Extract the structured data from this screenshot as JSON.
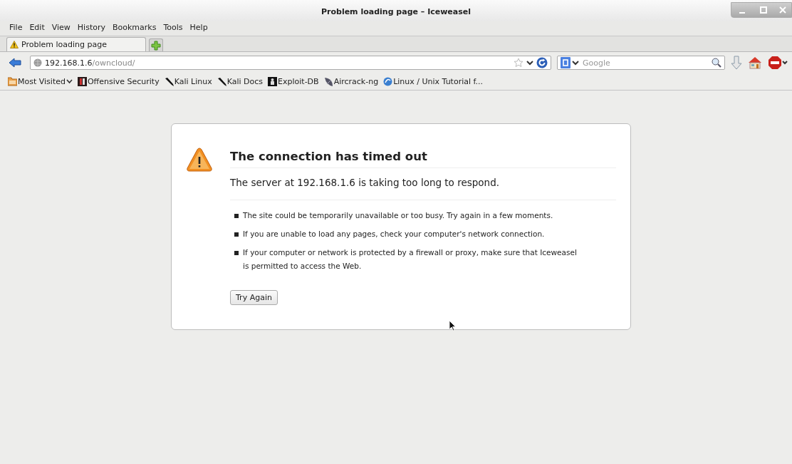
{
  "window": {
    "title": "Problem loading page – Iceweasel"
  },
  "menu": [
    "File",
    "Edit",
    "View",
    "History",
    "Bookmarks",
    "Tools",
    "Help"
  ],
  "tabs": [
    {
      "label": "Problem loading page",
      "selected": true
    }
  ],
  "address_bar": {
    "url_host": "192.168.1.6",
    "url_path": "/owncloud/"
  },
  "search": {
    "placeholder": "Google"
  },
  "bookmarks": [
    {
      "kind": "folder",
      "label": "Most Visited"
    },
    {
      "kind": "offsec",
      "label": "Offensive Security"
    },
    {
      "kind": "kali",
      "label": "Kali Linux"
    },
    {
      "kind": "kali",
      "label": "Kali Docs"
    },
    {
      "kind": "exploitdb",
      "label": "Exploit-DB"
    },
    {
      "kind": "aircrack",
      "label": "Aircrack-ng"
    },
    {
      "kind": "linux",
      "label": "Linux / Unix Tutorial f..."
    }
  ],
  "error": {
    "title": "The connection has timed out",
    "subtitle": "The server at 192.168.1.6 is taking too long to respond.",
    "items": [
      "The site could be temporarily unavailable or too busy. Try again in a few moments.",
      "If you are unable to load any pages, check your computer's network connection.",
      "If your computer or network is protected by a firewall or proxy, make sure that Iceweasel is permitted to access the Web."
    ],
    "button": "Try Again"
  }
}
